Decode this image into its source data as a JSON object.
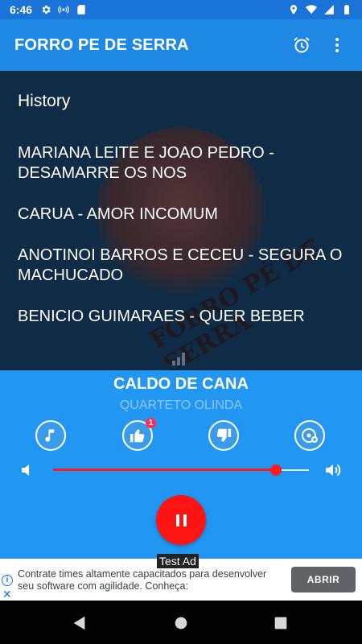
{
  "status_bar": {
    "time": "6:46",
    "left_icons": [
      "settings-icon",
      "hotspot-icon",
      "sd-card-icon"
    ],
    "right_icons": [
      "location-icon",
      "wifi-icon",
      "signal-icon",
      "battery-icon"
    ]
  },
  "app_bar": {
    "title": "FORRO PE DE SERRA",
    "actions": [
      "alarm-icon",
      "more-vert-icon"
    ]
  },
  "history": {
    "heading": "History",
    "items": [
      "MARIANA LEITE E JOAO PEDRO - DESAMARRE OS NOS",
      "CARUA - AMOR INCOMUM",
      "ANOTINOI BARROS E CECEU - SEGURA O MACHUCADO",
      "BENICIO GUIMARAES - QUER BEBER"
    ],
    "logo_text": "FORRO PÉ DE SERRA"
  },
  "player": {
    "title": "CALDO DE CANA",
    "artist": "QUARTETO OLINDA",
    "like_count": "1",
    "volume_level": 0.87,
    "state": "playing"
  },
  "ad": {
    "label": "Test Ad",
    "text": "Contrate times altamente capacitados para desenvolver seu software com agilidade. Conheça:",
    "cta": "ABRIR"
  },
  "colors": {
    "app_bar": "#1e88e5",
    "history_bg": "#0f2b45",
    "player_bg": "#2196f3",
    "accent": "#ff1414"
  }
}
